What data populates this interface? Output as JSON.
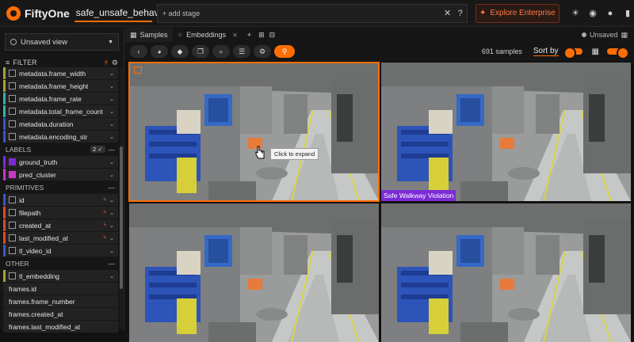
{
  "app": {
    "name": "FiftyOne"
  },
  "dataset": {
    "name": "safe_unsafe_behaviours"
  },
  "stages": {
    "add_label": "+ add stage"
  },
  "enterprise": {
    "label": "Explore Enterprise"
  },
  "view": {
    "label": "Unsaved view"
  },
  "filter": {
    "label": "FILTER"
  },
  "fields_top": [
    {
      "label": "metadata.frame_width",
      "color": "#a8a23a"
    },
    {
      "label": "metadata.frame_height",
      "color": "#a8a23a"
    },
    {
      "label": "metadata.frame_rate",
      "color": "#3ab0a8"
    },
    {
      "label": "metadata.total_frame_count",
      "color": "#3ab0a8"
    },
    {
      "label": "metadata.duration",
      "color": "#3a55c8"
    },
    {
      "label": "metadata.encoding_str",
      "color": "#3a55c8"
    }
  ],
  "labels_section": {
    "title": "LABELS",
    "count": "2"
  },
  "label_fields": [
    {
      "label": "ground_truth",
      "color": "#7b2bd6"
    },
    {
      "label": "pred_cluster",
      "color": "#c838c8"
    }
  ],
  "primitives_section": {
    "title": "PRIMITIVES"
  },
  "primitive_fields": [
    {
      "label": "id",
      "color": "#3a55c8"
    },
    {
      "label": "filepath",
      "color": "#d84b2a"
    },
    {
      "label": "created_at",
      "color": "#d84b2a"
    },
    {
      "label": "last_modified_at",
      "color": "#d84b2a"
    },
    {
      "label": "tl_video_id",
      "color": "#3a55c8"
    }
  ],
  "other_section": {
    "title": "OTHER"
  },
  "other_fields": [
    {
      "label": "tl_embedding",
      "color": "#a8a23a"
    }
  ],
  "frame_fields": [
    "frames.id",
    "frames.frame_number",
    "frames.created_at",
    "frames.last_modified_at"
  ],
  "tabs": [
    {
      "label": "Samples",
      "icon": "grid-icon"
    },
    {
      "label": "Embeddings",
      "icon": "scatter-icon"
    }
  ],
  "status": {
    "unsaved": "Unsaved"
  },
  "toolbar": {
    "count": "691 samples",
    "sort": "Sort by"
  },
  "samples": [
    {
      "label": ""
    },
    {
      "label": "Safe Walkway Violation",
      "label_color": "#7b2bd6"
    },
    {
      "label": ""
    },
    {
      "label": ""
    }
  ],
  "tooltip": {
    "text": "Click to expand"
  }
}
